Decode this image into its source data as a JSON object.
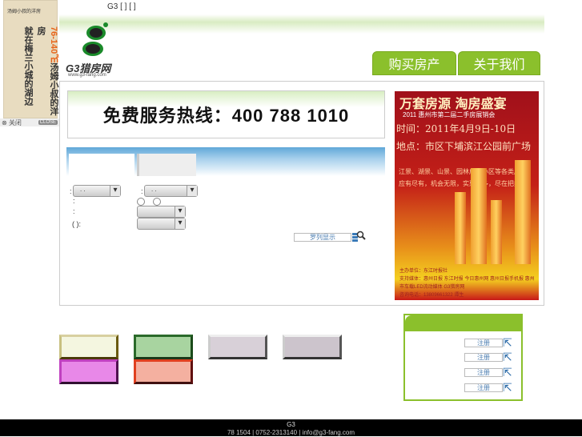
{
  "ad": {
    "brand": "汤姆小叔的洋房",
    "line1_size": "76-140㎡",
    "line1_rest": "汤姆小叔的洋房",
    "line2": "就在梅兰小城的湖边",
    "close": "关闭",
    "close_badge": "CLOSE"
  },
  "top_links": "G3 [ ] [ ]",
  "logo": {
    "name": "G3猎房网",
    "url": "www.g3-fang.com"
  },
  "nav": {
    "tabs": [
      {
        "label": "购买房产"
      },
      {
        "label": "关于我们"
      }
    ]
  },
  "hotline": "免费服务热线：400 788 1010",
  "search": {
    "labels": [
      ":",
      ":",
      ":",
      ":",
      "( ):"
    ],
    "select_a": ". .",
    "select_b": ". .",
    "row_button": "罗列显示"
  },
  "poster": {
    "title": "万套房源  淘房盛宴",
    "subtitle": "2011 惠州市第二届二手房展销会",
    "time": "时间：2011年4月9日-10日",
    "place": "地点：市区下埔滨江公园前广场",
    "body": "江景、湖景、山景、园林成熟小区等各类房源，应有尽有，机会无限，实惠多多，尽在把握。",
    "host": "主办单位：东江时报社",
    "media": "支持媒体：惠州日报 东江时报 今日惠州网 惠州日报手机报 惠州市车载LED流动媒体 G3猎房网",
    "phone": "咨询电话：13809661322  谭生"
  },
  "register": {
    "items": [
      "注册",
      "注册",
      "注册",
      "注册"
    ]
  },
  "footer": {
    "line1": "G3",
    "line2": "78 1504 | 0752-2313140 | info@g3-fang.com"
  },
  "colors": {
    "green": "#8bc02c",
    "footer": "#000000"
  }
}
